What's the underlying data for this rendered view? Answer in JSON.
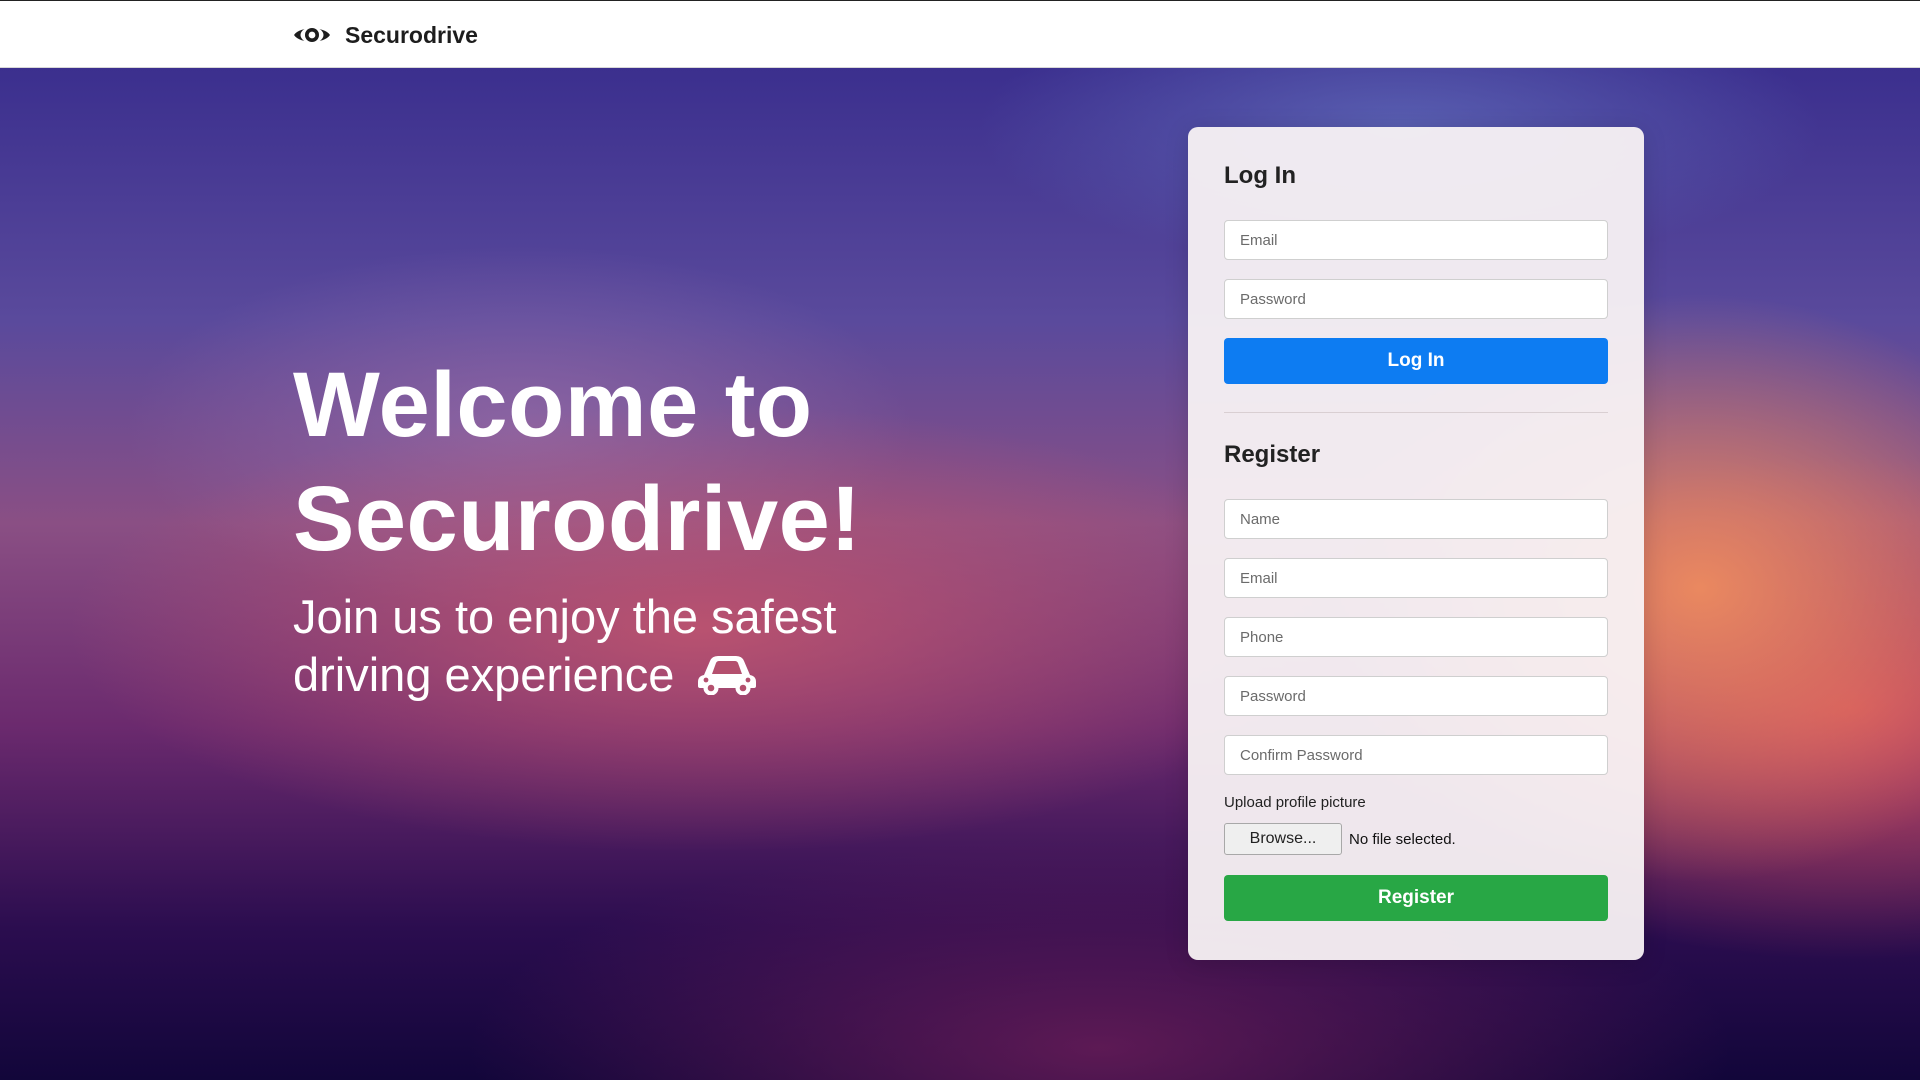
{
  "nav": {
    "brand_name": "Securodrive",
    "brand_icon": "eye-icon"
  },
  "hero": {
    "title": "Welcome to Securodrive!",
    "subtitle": "Join us to enjoy the safest driving experience",
    "subtitle_icon": "car-icon"
  },
  "login": {
    "title": "Log In",
    "email_placeholder": "Email",
    "password_placeholder": "Password",
    "submit_label": "Log In",
    "button_color": "#0d7cf2"
  },
  "register": {
    "title": "Register",
    "name_placeholder": "Name",
    "email_placeholder": "Email",
    "phone_placeholder": "Phone",
    "password_placeholder": "Password",
    "confirm_password_placeholder": "Confirm Password",
    "upload_label": "Upload profile picture",
    "browse_label": "Browse...",
    "file_status": "No file selected.",
    "submit_label": "Register",
    "button_color": "#28a745"
  }
}
